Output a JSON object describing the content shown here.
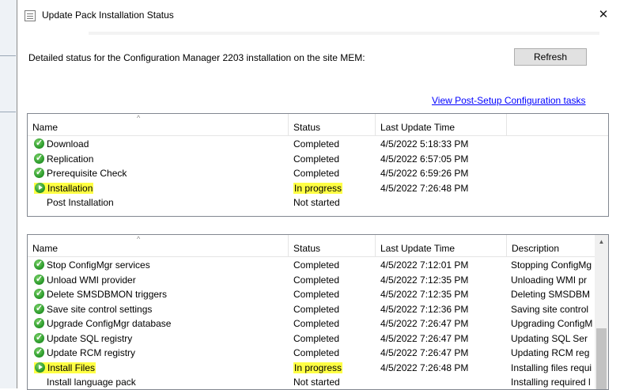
{
  "window": {
    "title": "Update Pack Installation Status",
    "close_glyph": "✕"
  },
  "header": {
    "text": "Detailed status for the Configuration Manager 2203 installation on the site MEM:",
    "refresh_label": "Refresh",
    "post_setup_link": "View Post-Setup Configuration tasks"
  },
  "columns_top": [
    "Name",
    "Status",
    "Last Update Time"
  ],
  "steps_top": [
    {
      "name": "Download",
      "status": "Completed",
      "time": "4/5/2022 5:18:33 PM",
      "icon": "check-icon",
      "highlight": false
    },
    {
      "name": "Replication",
      "status": "Completed",
      "time": "4/5/2022 6:57:05 PM",
      "icon": "check-icon",
      "highlight": false
    },
    {
      "name": "Prerequisite Check",
      "status": "Completed",
      "time": "4/5/2022 6:59:26 PM",
      "icon": "check-icon",
      "highlight": false
    },
    {
      "name": "Installation",
      "status": "In progress",
      "time": "4/5/2022 7:26:48 PM",
      "icon": "play-icon",
      "highlight": true
    },
    {
      "name": "Post Installation",
      "status": "Not started",
      "time": "",
      "icon": "none",
      "highlight": false
    }
  ],
  "columns_bottom": [
    "Name",
    "Status",
    "Last Update Time",
    "Description"
  ],
  "steps_bottom": [
    {
      "name": "Stop ConfigMgr services",
      "status": "Completed",
      "time": "4/5/2022 7:12:01 PM",
      "desc": "Stopping ConfigMg",
      "icon": "check-icon",
      "highlight": false
    },
    {
      "name": "Unload WMI provider",
      "status": "Completed",
      "time": "4/5/2022 7:12:35 PM",
      "desc": "Unloading WMI pr",
      "icon": "check-icon",
      "highlight": false
    },
    {
      "name": "Delete SMSDBMON triggers",
      "status": "Completed",
      "time": "4/5/2022 7:12:35 PM",
      "desc": "Deleting SMSDBM",
      "icon": "check-icon",
      "highlight": false
    },
    {
      "name": "Save site control settings",
      "status": "Completed",
      "time": "4/5/2022 7:12:36 PM",
      "desc": "Saving site control",
      "icon": "check-icon",
      "highlight": false
    },
    {
      "name": "Upgrade ConfigMgr database",
      "status": "Completed",
      "time": "4/5/2022 7:26:47 PM",
      "desc": "Upgrading ConfigM",
      "icon": "check-icon",
      "highlight": false
    },
    {
      "name": "Update SQL registry",
      "status": "Completed",
      "time": "4/5/2022 7:26:47 PM",
      "desc": "Updating SQL Ser",
      "icon": "check-icon",
      "highlight": false
    },
    {
      "name": "Update RCM registry",
      "status": "Completed",
      "time": "4/5/2022 7:26:47 PM",
      "desc": "Updating RCM reg",
      "icon": "check-icon",
      "highlight": false
    },
    {
      "name": "Install Files",
      "status": "In progress",
      "time": "4/5/2022 7:26:48 PM",
      "desc": "Installing files requi",
      "icon": "play-icon",
      "highlight": true
    },
    {
      "name": "Install language pack",
      "status": "Not started",
      "time": "",
      "desc": "Installing required l",
      "icon": "none",
      "highlight": false
    }
  ],
  "colors": {
    "highlight": "#ffff44",
    "link": "#0000ff",
    "status_green": "#2e9d2e"
  }
}
